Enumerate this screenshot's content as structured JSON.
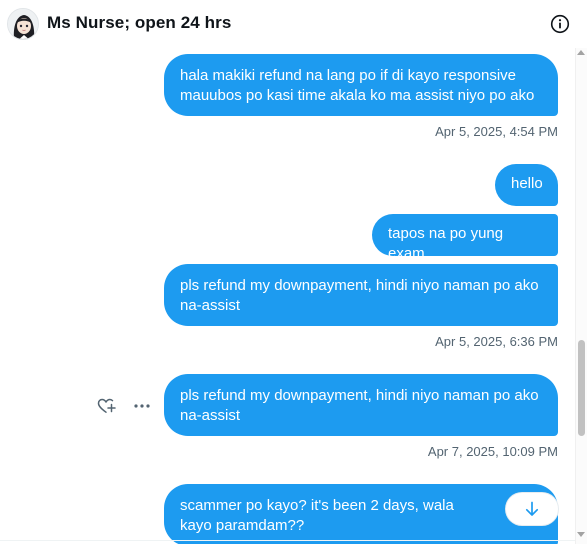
{
  "header": {
    "title": "Ms Nurse; open 24 hrs"
  },
  "messages": [
    {
      "text": "hala makiki refund na lang po if di kayo responsive mauubos po kasi time akala ko ma assist niyo po ako",
      "timestamp": "Apr 5, 2025, 4:54 PM"
    },
    {
      "text": "hello"
    },
    {
      "text": "tapos na po yung exam"
    },
    {
      "text": "pls refund my downpayment, hindi niyo naman po ako na-assist",
      "timestamp": "Apr 5, 2025, 6:36 PM"
    },
    {
      "text": "pls refund my downpayment, hindi niyo naman po ako na-assist",
      "timestamp": "Apr 7, 2025, 10:09 PM"
    },
    {
      "text": "scammer po kayo? it's been 2 days, wala kayo paramdam??"
    }
  ],
  "colors": {
    "bubble": "#1d9bf0",
    "timestamp": "#536471"
  },
  "icons": {
    "info": "info-circle-icon",
    "react": "heart-plus-icon",
    "more": "more-horizontal-icon",
    "scroll_down": "arrow-down-icon"
  }
}
